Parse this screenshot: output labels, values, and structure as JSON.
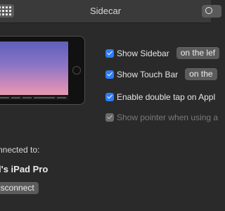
{
  "window": {
    "title": "Sidecar"
  },
  "options": {
    "show_sidebar": {
      "label": "Show Sidebar",
      "checked": true,
      "select_value": "on the lef"
    },
    "show_touch_bar": {
      "label": "Show Touch Bar",
      "checked": true,
      "select_value": "on the"
    },
    "double_tap": {
      "label": "Enable double tap on Appl",
      "checked": true
    },
    "show_pointer": {
      "label": "Show pointer when using a",
      "checked": true,
      "disabled": true
    }
  },
  "connection": {
    "label": "nnected to:",
    "device_name": "l's iPad Pro",
    "disconnect_label": "isconnect"
  },
  "colors": {
    "accent": "#2f7cf6",
    "window_bg": "#2a2a2a",
    "titlebar_bg": "#3a3a3a"
  }
}
